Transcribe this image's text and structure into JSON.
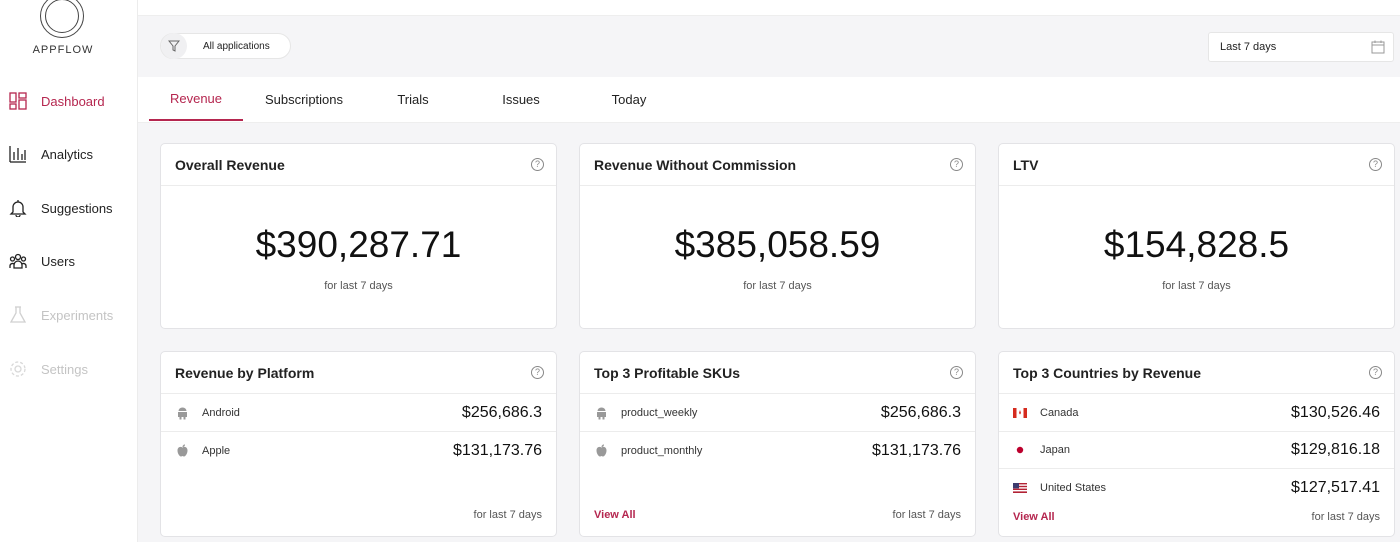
{
  "brand": "APPFLOW",
  "nav": [
    {
      "label": "Dashboard",
      "icon": "grid-icon",
      "state": "active"
    },
    {
      "label": "Analytics",
      "icon": "bar-chart-icon",
      "state": "normal"
    },
    {
      "label": "Suggestions",
      "icon": "bell-icon",
      "state": "normal"
    },
    {
      "label": "Users",
      "icon": "users-icon",
      "state": "normal"
    },
    {
      "label": "Experiments",
      "icon": "flask-icon",
      "state": "disabled"
    },
    {
      "label": "Settings",
      "icon": "gear-icon",
      "state": "disabled"
    }
  ],
  "filter": {
    "apps_label": "All applications",
    "date_label": "Last 7 days"
  },
  "tabs": [
    "Revenue",
    "Subscriptions",
    "Trials",
    "Issues",
    "Today"
  ],
  "active_tab": "Revenue",
  "accent": "#b5264f",
  "kpis": [
    {
      "title": "Overall Revenue",
      "value": "$390,287.71",
      "sub": "for last 7 days"
    },
    {
      "title": "Revenue Without Commission",
      "value": "$385,058.59",
      "sub": "for last 7 days"
    },
    {
      "title": "LTV",
      "value": "$154,828.5",
      "sub": "for last 7 days"
    }
  ],
  "platform": {
    "title": "Revenue by Platform",
    "rows": [
      {
        "label": "Android",
        "value": "$256,686.3",
        "icon": "android-icon"
      },
      {
        "label": "Apple",
        "value": "$131,173.76",
        "icon": "apple-icon"
      }
    ],
    "sub": "for last 7 days"
  },
  "skus": {
    "title": "Top 3 Profitable SKUs",
    "rows": [
      {
        "label": "product_weekly",
        "value": "$256,686.3",
        "icon": "android-icon"
      },
      {
        "label": "product_monthly",
        "value": "$131,173.76",
        "icon": "apple-icon"
      }
    ],
    "view_all": "View All",
    "sub": "for last 7 days"
  },
  "countries": {
    "title": "Top 3 Countries by Revenue",
    "rows": [
      {
        "label": "Canada",
        "value": "$130,526.46",
        "icon": "canada-flag-icon"
      },
      {
        "label": "Japan",
        "value": "$129,816.18",
        "icon": "japan-flag-icon"
      },
      {
        "label": "United States",
        "value": "$127,517.41",
        "icon": "us-flag-icon"
      }
    ],
    "view_all": "View All",
    "sub": "for last 7 days"
  }
}
